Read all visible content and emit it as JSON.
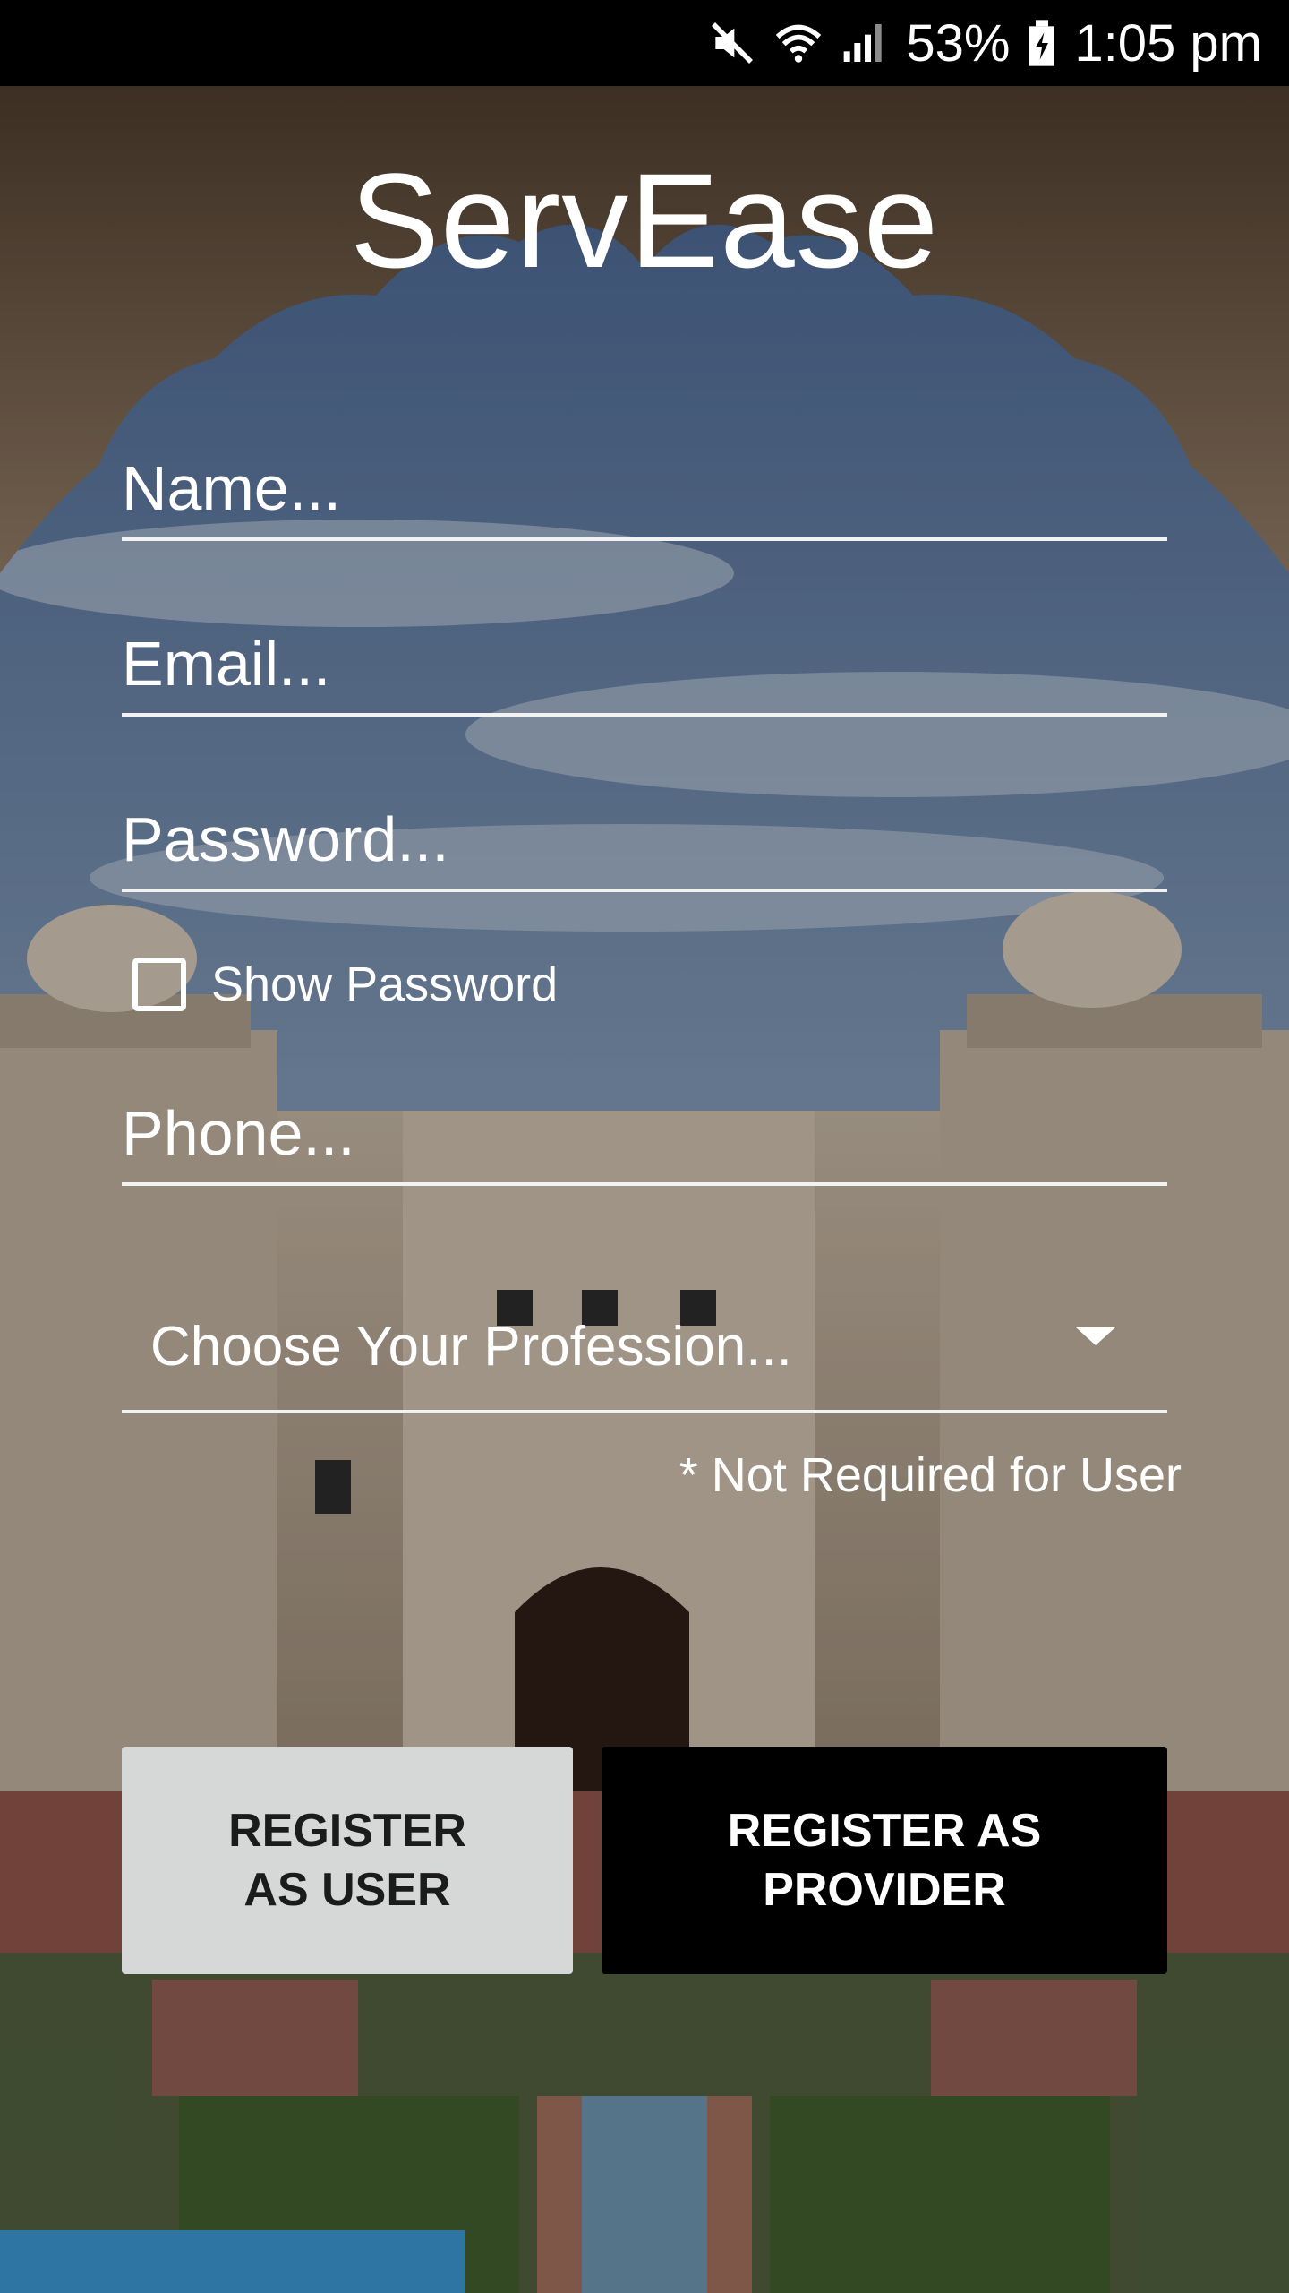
{
  "status_bar": {
    "battery_percent": "53%",
    "time": "1:05 pm",
    "icons": [
      "mute-icon",
      "wifi-icon",
      "cell-signal-icon",
      "battery-charging-icon"
    ]
  },
  "app": {
    "title": "ServEase"
  },
  "form": {
    "name_placeholder": "Name...",
    "email_placeholder": "Email...",
    "password_placeholder": "Password...",
    "show_password_label": "Show Password",
    "show_password_checked": false,
    "phone_placeholder": "Phone...",
    "profession_label": "Choose Your Profession...",
    "profession_note": "* Not Required for User"
  },
  "buttons": {
    "register_user": "REGISTER\nAS USER",
    "register_provider": "REGISTER AS\nPROVIDER"
  },
  "colors": {
    "button_user_bg": "#d6d7d7",
    "button_provider_bg": "#000000",
    "text": "#ffffff",
    "field_underline": "#f2f2f2"
  }
}
